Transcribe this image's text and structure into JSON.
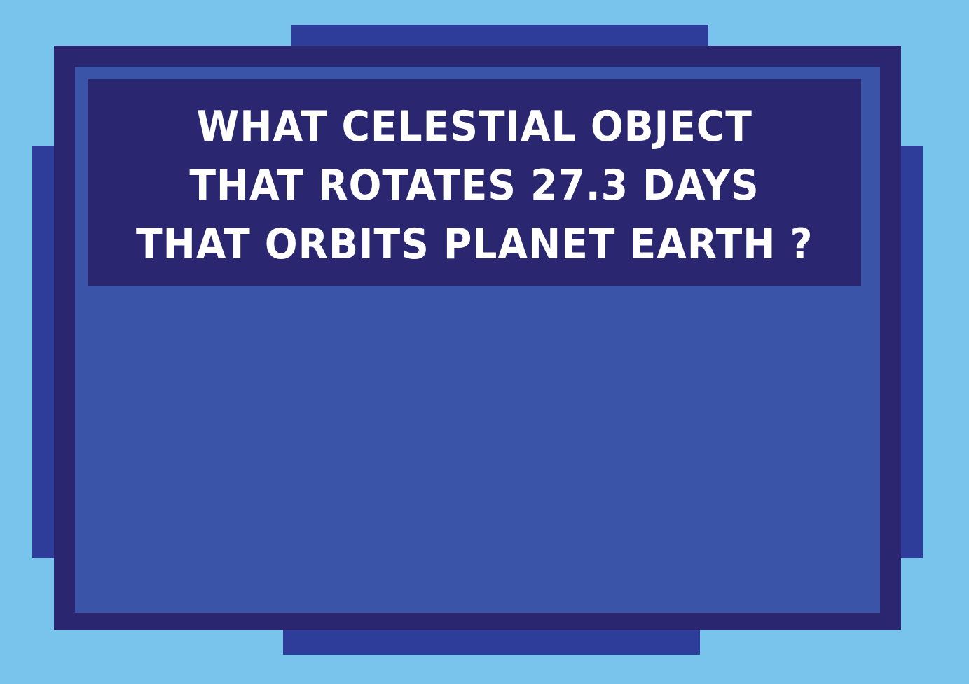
{
  "colors": {
    "background": "#78c4ec",
    "tabs": "#2e3d9a",
    "frame": "#2a2670",
    "panel": "#3a54a7",
    "question_box": "#2a2670",
    "question_text": "#ffffff"
  },
  "question": {
    "lines": [
      "WHAT CELESTIAL OBJECT",
      "THAT ROTATES 27.3 DAYS",
      "THAT ORBITS PLANET EARTH ?"
    ]
  }
}
